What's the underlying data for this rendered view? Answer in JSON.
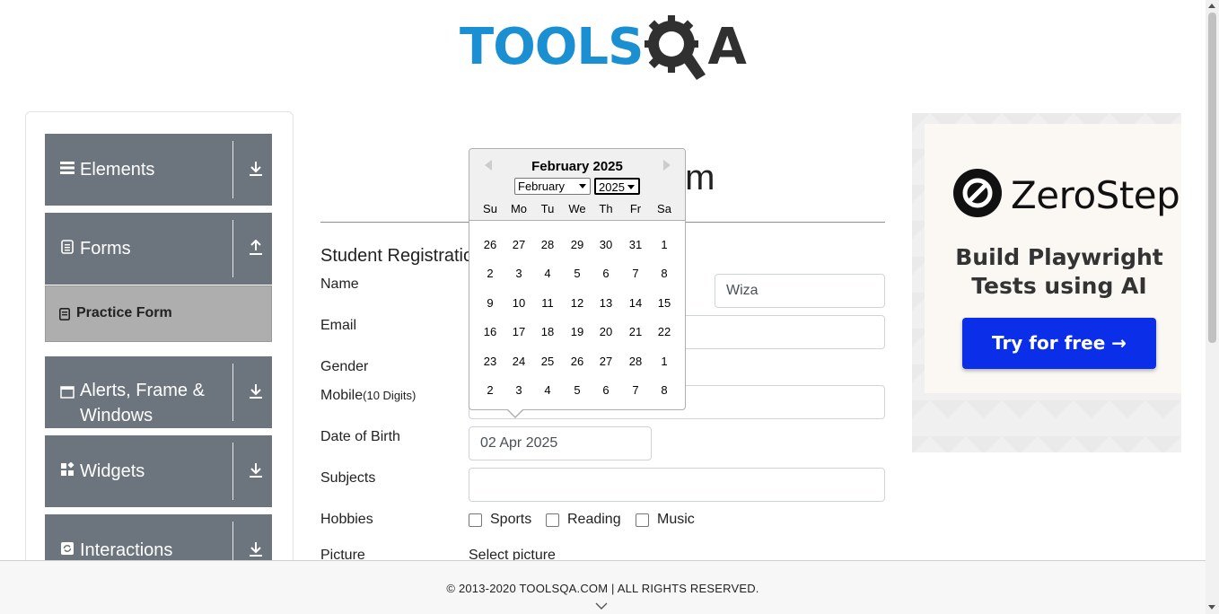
{
  "header": {
    "logo_tools": "TOOLS",
    "logo_qa": "A"
  },
  "sidebar": {
    "groups": [
      {
        "label": "Elements",
        "icon": "hamburger-icon"
      },
      {
        "label": "Forms",
        "icon": "document-icon"
      },
      {
        "label": "Alerts, Frame &",
        "label2": "Windows",
        "icon": "window-icon"
      },
      {
        "label": "Widgets",
        "icon": "widgets-icon"
      },
      {
        "label": "Interactions",
        "icon": "refresh-icon"
      }
    ],
    "active_item": "Practice Form"
  },
  "main": {
    "title": "Practice Form",
    "heading": "Student Registration Form",
    "labels": {
      "name": "Name",
      "email": "Email",
      "gender": "Gender",
      "mobile": "Mobile",
      "mobile_hint": "(10 Digits)",
      "dob": "Date of Birth",
      "subjects": "Subjects",
      "hobbies": "Hobbies",
      "picture": "Picture"
    },
    "values": {
      "last_name": "Wiza",
      "dob": "02 Apr 2025",
      "subjects": ""
    },
    "hobbies": [
      "Sports",
      "Reading",
      "Music"
    ],
    "picture_button": "Select picture"
  },
  "datepicker": {
    "title": "February 2025",
    "month_selected": "February",
    "year_selected": "2025",
    "weekdays": [
      "Su",
      "Mo",
      "Tu",
      "We",
      "Th",
      "Fr",
      "Sa"
    ],
    "weeks": [
      [
        "26",
        "27",
        "28",
        "29",
        "30",
        "31",
        "1"
      ],
      [
        "2",
        "3",
        "4",
        "5",
        "6",
        "7",
        "8"
      ],
      [
        "9",
        "10",
        "11",
        "12",
        "13",
        "14",
        "15"
      ],
      [
        "16",
        "17",
        "18",
        "19",
        "20",
        "21",
        "22"
      ],
      [
        "23",
        "24",
        "25",
        "26",
        "27",
        "28",
        "1"
      ],
      [
        "2",
        "3",
        "4",
        "5",
        "6",
        "7",
        "8"
      ]
    ]
  },
  "ad": {
    "brand": "ZeroStep",
    "headline_line1": "Build Playwright",
    "headline_line2": "Tests using AI",
    "cta": "Try for free →"
  },
  "footer": {
    "text": "© 2013-2020 TOOLSQA.COM | ALL RIGHTS RESERVED."
  },
  "colors": {
    "sidebar_bg": "#6c757d",
    "logo_blue": "#1a8fd1",
    "cta_blue": "#0b2ee8"
  }
}
